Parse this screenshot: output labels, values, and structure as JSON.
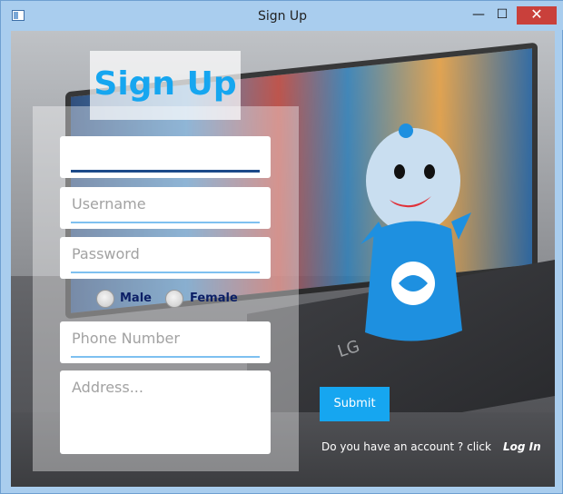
{
  "window": {
    "title": "Sign Up",
    "minimize": "—",
    "maximize": "☐",
    "close": "✕"
  },
  "form": {
    "heading": "Sign Up",
    "first_field_value": "",
    "username_placeholder": "Username",
    "password_placeholder": "Password",
    "gender_options": [
      "Male",
      "Female"
    ],
    "phone_placeholder": "Phone Number",
    "address_placeholder": "Address...",
    "submit_label": "Submit",
    "account_prompt": "Do you have an account ? click",
    "login_link": "Log In"
  },
  "background": {
    "brand_text": "LG"
  },
  "colors": {
    "accent": "#16a6f0",
    "active_underline": "#1c4a8a",
    "close_button": "#c9403b"
  },
  "icons": {
    "app": "window-icon",
    "mascot": "mascot-character"
  }
}
